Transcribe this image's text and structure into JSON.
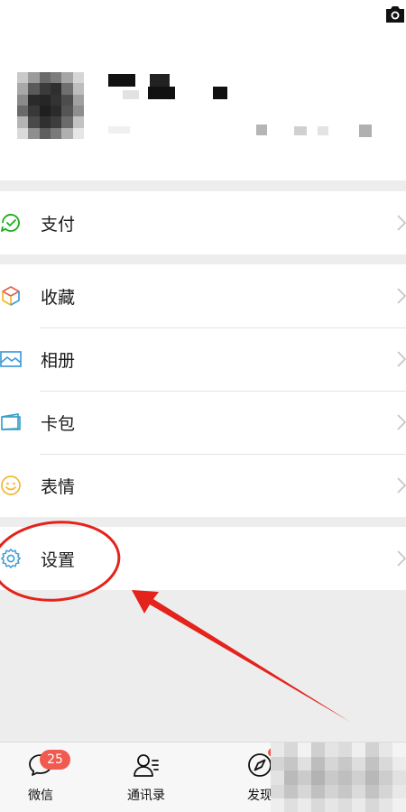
{
  "menu": {
    "pay": {
      "label": "支付",
      "icon": "wallet-check-icon"
    },
    "favorites": {
      "label": "收藏",
      "icon": "cube-icon"
    },
    "album": {
      "label": "相册",
      "icon": "landscape-icon"
    },
    "cards": {
      "label": "卡包",
      "icon": "card-pack-icon"
    },
    "stickers": {
      "label": "表情",
      "icon": "smiley-icon"
    },
    "settings": {
      "label": "设置",
      "icon": "gear-icon"
    }
  },
  "tabbar": {
    "chats": {
      "label": "微信",
      "badge": "25",
      "icon": "chat-bubble-icon"
    },
    "contacts": {
      "label": "通讯录",
      "icon": "contacts-icon"
    },
    "discover": {
      "label": "发现",
      "icon": "compass-icon"
    }
  },
  "colors": {
    "accent_green": "#1aad19",
    "badge_red": "#f05a4f",
    "annotation_red": "#e3231c",
    "background": "#ededed"
  }
}
